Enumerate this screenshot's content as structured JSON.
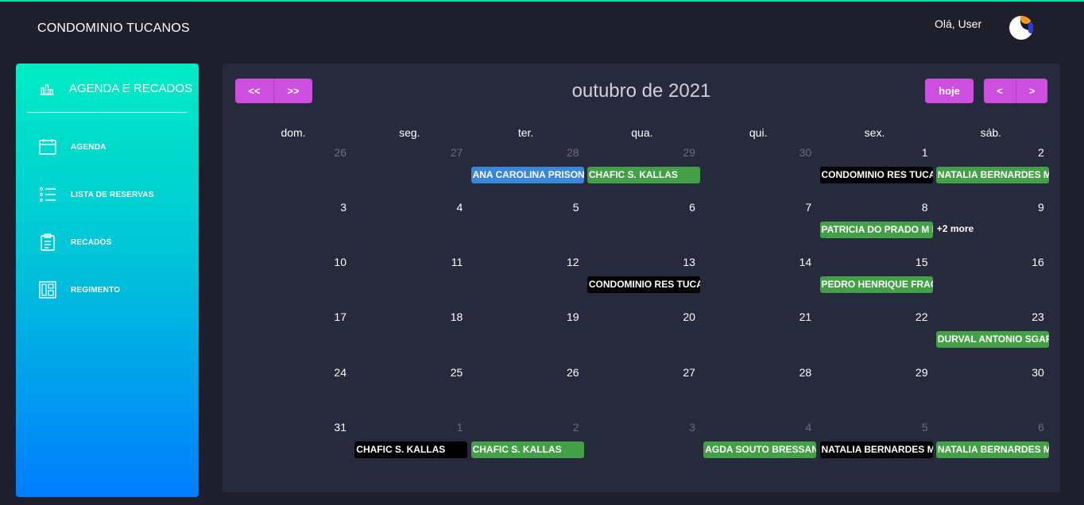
{
  "header": {
    "app_title": "CONDOMINIO TUCANOS",
    "greeting": "Olá, User"
  },
  "sidebar": {
    "title": "AGENDA E RECADOS",
    "title_icon": "bar-chart-icon",
    "items": [
      {
        "label": "AGENDA",
        "icon": "calendar-icon"
      },
      {
        "label": "LISTA DE RESERVAS",
        "icon": "list-icon"
      },
      {
        "label": "RECADOS",
        "icon": "clipboard-icon"
      },
      {
        "label": "REGIMENTO",
        "icon": "layout-icon"
      }
    ]
  },
  "calendar": {
    "title": "outubro de 2021",
    "buttons": {
      "prev_year": "<<",
      "next_year": ">>",
      "today": "hoje",
      "prev": "<",
      "next": ">"
    },
    "weekdays": [
      "dom.",
      "seg.",
      "ter.",
      "qua.",
      "qui.",
      "sex.",
      "sáb."
    ],
    "weeks": [
      [
        {
          "d": "26",
          "other": true
        },
        {
          "d": "27",
          "other": true
        },
        {
          "d": "28",
          "other": true
        },
        {
          "d": "29",
          "other": true
        },
        {
          "d": "30",
          "other": true
        },
        {
          "d": "1",
          "other": false
        },
        {
          "d": "2",
          "other": false
        }
      ],
      [
        {
          "d": "3",
          "other": false
        },
        {
          "d": "4",
          "other": false
        },
        {
          "d": "5",
          "other": false
        },
        {
          "d": "6",
          "other": false
        },
        {
          "d": "7",
          "other": false
        },
        {
          "d": "8",
          "other": false
        },
        {
          "d": "9",
          "other": false
        }
      ],
      [
        {
          "d": "10",
          "other": false
        },
        {
          "d": "11",
          "other": false
        },
        {
          "d": "12",
          "other": false
        },
        {
          "d": "13",
          "other": false
        },
        {
          "d": "14",
          "other": false
        },
        {
          "d": "15",
          "other": false
        },
        {
          "d": "16",
          "other": false
        }
      ],
      [
        {
          "d": "17",
          "other": false
        },
        {
          "d": "18",
          "other": false
        },
        {
          "d": "19",
          "other": false
        },
        {
          "d": "20",
          "other": false
        },
        {
          "d": "21",
          "other": false
        },
        {
          "d": "22",
          "other": false
        },
        {
          "d": "23",
          "other": false
        }
      ],
      [
        {
          "d": "24",
          "other": false
        },
        {
          "d": "25",
          "other": false
        },
        {
          "d": "26",
          "other": false
        },
        {
          "d": "27",
          "other": false
        },
        {
          "d": "28",
          "other": false
        },
        {
          "d": "29",
          "other": false
        },
        {
          "d": "30",
          "other": false
        }
      ],
      [
        {
          "d": "31",
          "other": false
        },
        {
          "d": "1",
          "other": true
        },
        {
          "d": "2",
          "other": true
        },
        {
          "d": "3",
          "other": true
        },
        {
          "d": "4",
          "other": true
        },
        {
          "d": "5",
          "other": true
        },
        {
          "d": "6",
          "other": true
        }
      ]
    ],
    "events": [
      {
        "week": 0,
        "col": 2,
        "title": "ANA CAROLINA PRISON",
        "color": "blue"
      },
      {
        "week": 0,
        "col": 3,
        "title": "CHAFIC S. KALLAS",
        "color": "green"
      },
      {
        "week": 0,
        "col": 5,
        "title": "CONDOMINIO RES TUCANOS",
        "color": "black"
      },
      {
        "week": 0,
        "col": 6,
        "title": "NATALIA BERNARDES MORAES",
        "color": "green"
      },
      {
        "week": 1,
        "col": 5,
        "title": "PATRICIA DO PRADO M BERNARDES",
        "color": "green"
      },
      {
        "week": 2,
        "col": 3,
        "title": "CONDOMINIO RES TUCANOS",
        "color": "black"
      },
      {
        "week": 2,
        "col": 5,
        "title": "PEDRO HENRIQUE FRAGA",
        "color": "green"
      },
      {
        "week": 3,
        "col": 6,
        "title": "DURVAL ANTONIO SGARBI",
        "color": "green"
      },
      {
        "week": 5,
        "col": 1,
        "title": "CHAFIC S. KALLAS",
        "color": "black"
      },
      {
        "week": 5,
        "col": 2,
        "title": "CHAFIC S. KALLAS",
        "color": "green"
      },
      {
        "week": 5,
        "col": 4,
        "title": "AGDA SOUTO BRESSAN",
        "color": "green"
      },
      {
        "week": 5,
        "col": 5,
        "title": "NATALIA BERNARDES MORAES",
        "color": "black"
      },
      {
        "week": 5,
        "col": 6,
        "title": "NATALIA BERNARDES MORAES",
        "color": "green"
      }
    ],
    "more_links": [
      {
        "week": 1,
        "col": 6,
        "label": "+2 more"
      }
    ]
  }
}
